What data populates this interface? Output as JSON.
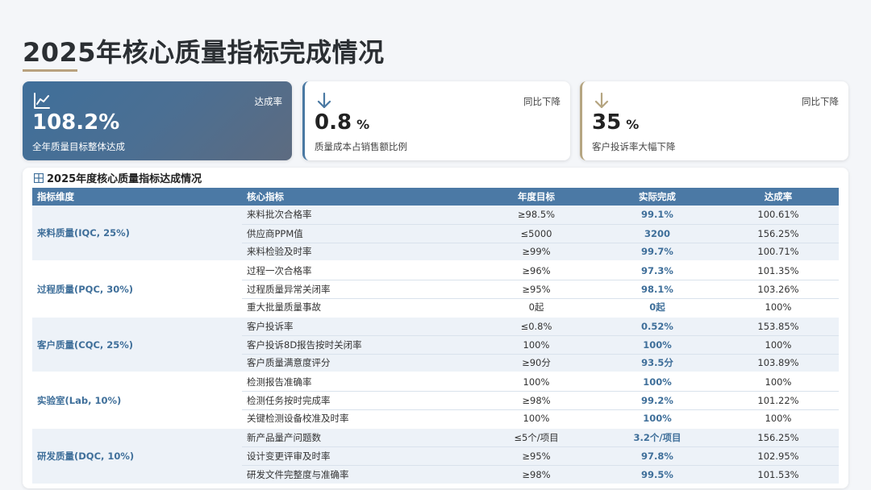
{
  "page": {
    "title": "2025年核心质量指标完成情况"
  },
  "cards": [
    {
      "tag": "达成率",
      "value": "108.2%",
      "unit": "",
      "desc": "全年质量目标整体达成",
      "icon": "line-chart-icon"
    },
    {
      "tag": "同比下降",
      "value": "0.8",
      "unit": "%",
      "desc": "质量成本占销售额比例",
      "icon": "arrow-down-icon"
    },
    {
      "tag": "同比下降",
      "value": "35",
      "unit": "%",
      "desc": "客户投诉率大幅下降",
      "icon": "arrow-down-icon"
    }
  ],
  "colors": {
    "accent": "#4b79a5",
    "gold": "#b5a581",
    "row_alt": "#edf2f8"
  },
  "table": {
    "title": "2025年度核心质量指标达成情况",
    "icon": "table-grid-icon",
    "headers": [
      "指标维度",
      "核心指标",
      "年度目标",
      "实际完成",
      "达成率"
    ],
    "groups": [
      {
        "dimension": "来料质量(IQC, 25%)",
        "rows": [
          {
            "indicator": "来料批次合格率",
            "target": "≥98.5%",
            "actual": "99.1%",
            "rate": "100.61%"
          },
          {
            "indicator": "供应商PPM值",
            "target": "≤5000",
            "actual": "3200",
            "rate": "156.25%"
          },
          {
            "indicator": "来料检验及时率",
            "target": "≥99%",
            "actual": "99.7%",
            "rate": "100.71%"
          }
        ]
      },
      {
        "dimension": "过程质量(PQC, 30%)",
        "rows": [
          {
            "indicator": "过程一次合格率",
            "target": "≥96%",
            "actual": "97.3%",
            "rate": "101.35%"
          },
          {
            "indicator": "过程质量异常关闭率",
            "target": "≥95%",
            "actual": "98.1%",
            "rate": "103.26%"
          },
          {
            "indicator": "重大批量质量事故",
            "target": "0起",
            "actual": "0起",
            "rate": "100%"
          }
        ]
      },
      {
        "dimension": "客户质量(CQC, 25%)",
        "rows": [
          {
            "indicator": "客户投诉率",
            "target": "≤0.8%",
            "actual": "0.52%",
            "rate": "153.85%"
          },
          {
            "indicator": "客户投诉8D报告按时关闭率",
            "target": "100%",
            "actual": "100%",
            "rate": "100%"
          },
          {
            "indicator": "客户质量满意度评分",
            "target": "≥90分",
            "actual": "93.5分",
            "rate": "103.89%"
          }
        ]
      },
      {
        "dimension": "实验室(Lab, 10%)",
        "rows": [
          {
            "indicator": "检测报告准确率",
            "target": "100%",
            "actual": "100%",
            "rate": "100%"
          },
          {
            "indicator": "检测任务按时完成率",
            "target": "≥98%",
            "actual": "99.2%",
            "rate": "101.22%"
          },
          {
            "indicator": "关键检测设备校准及时率",
            "target": "100%",
            "actual": "100%",
            "rate": "100%"
          }
        ]
      },
      {
        "dimension": "研发质量(DQC, 10%)",
        "rows": [
          {
            "indicator": "新产品量产问题数",
            "target": "≤5个/项目",
            "actual": "3.2个/项目",
            "rate": "156.25%"
          },
          {
            "indicator": "设计变更评审及时率",
            "target": "≥95%",
            "actual": "97.8%",
            "rate": "102.95%"
          },
          {
            "indicator": "研发文件完整度与准确率",
            "target": "≥98%",
            "actual": "99.5%",
            "rate": "101.53%"
          }
        ]
      }
    ]
  }
}
